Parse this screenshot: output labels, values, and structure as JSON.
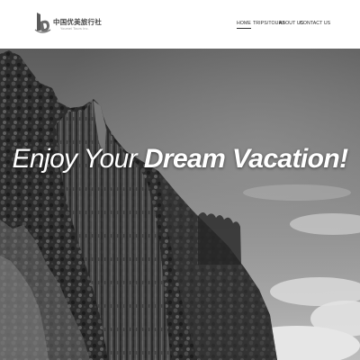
{
  "header": {
    "logo": {
      "name": "中国优美旅行社",
      "subtitle": "Youmei Tours Inc."
    },
    "nav": {
      "items": [
        {
          "label": "HOME",
          "active": true
        },
        {
          "label": "TRIPS/TOURS",
          "active": false
        },
        {
          "label": "ABOUT US",
          "active": false
        },
        {
          "label": "CONTACT US",
          "active": false
        }
      ]
    }
  },
  "hero": {
    "title_part1": "Enjoy Your",
    "title_part2": "Dream Vacation!"
  },
  "colors": {
    "header_bg": "#ffffff",
    "nav_text": "#2a2a2a",
    "hero_text": "#ffffff",
    "hero_tone": "grayscale"
  }
}
